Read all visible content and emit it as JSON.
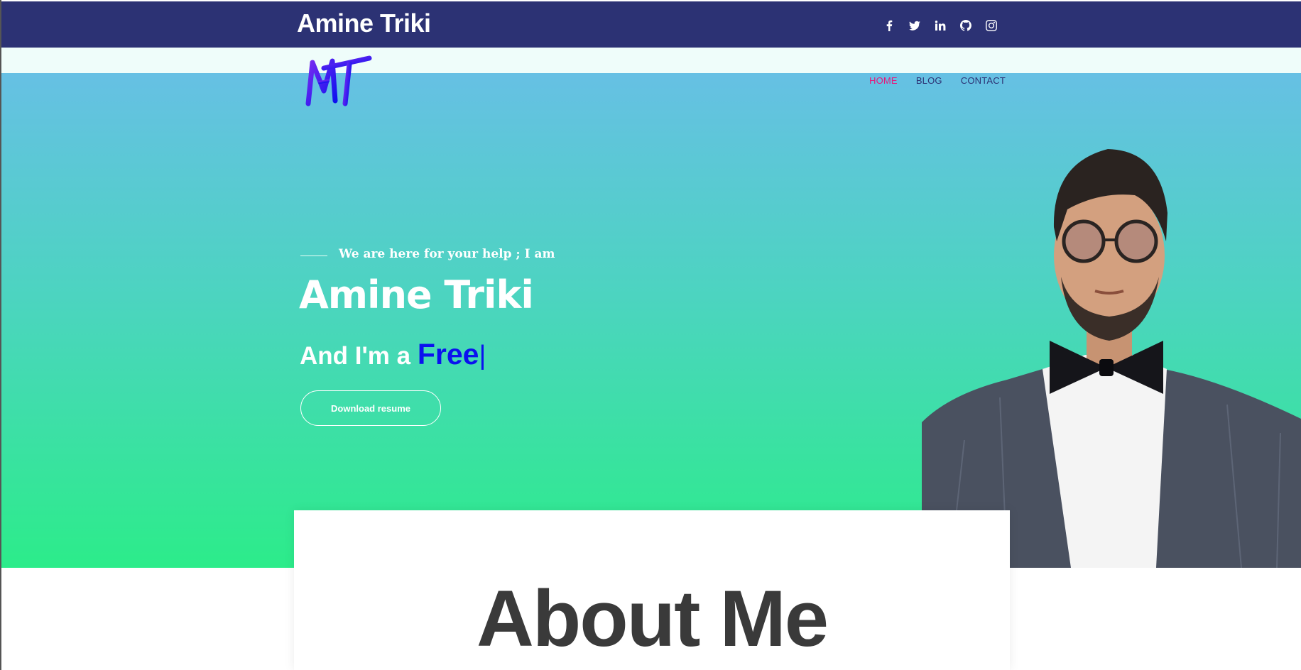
{
  "header": {
    "site_title": "Amine Triki",
    "socials": [
      {
        "icon": "facebook-icon"
      },
      {
        "icon": "twitter-icon"
      },
      {
        "icon": "linkedin-icon"
      },
      {
        "icon": "github-icon"
      },
      {
        "icon": "instagram-icon"
      }
    ]
  },
  "nav": {
    "logo_text": "AMT",
    "items": [
      {
        "label": "HOME",
        "active": true
      },
      {
        "label": "BLOG",
        "active": false
      },
      {
        "label": "CONTACT",
        "active": false
      }
    ]
  },
  "hero": {
    "tagline": "We are here for your help ; I am",
    "name": "Amine Triki",
    "role_prefix": "And I'm a ",
    "role_typed": "Free",
    "cursor": "|",
    "download_label": "Download resume",
    "gradient_top": "#66c0e4",
    "gradient_bottom": "#2cec8a"
  },
  "about": {
    "title": "About Me"
  },
  "colors": {
    "top_bar": "#2c3274",
    "nav_active": "#e6187c",
    "accent_blue": "#0b11ef"
  }
}
